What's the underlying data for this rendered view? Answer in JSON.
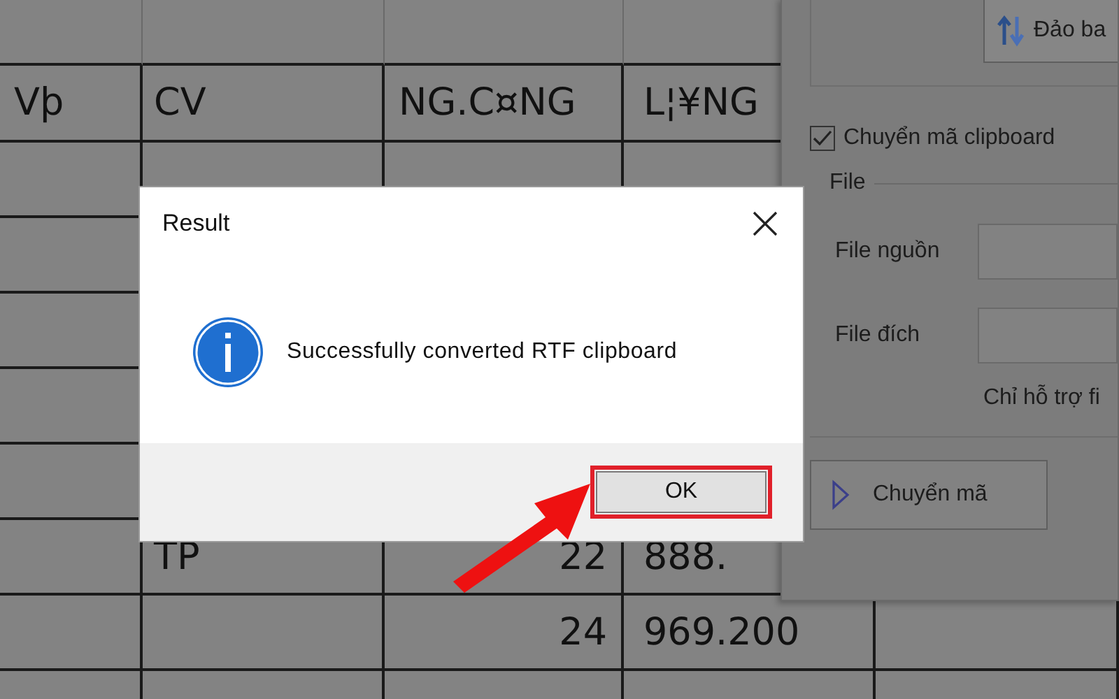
{
  "sheet": {
    "columns": [
      "Vþ",
      "CV",
      "NG.C¤NG",
      "L¦¥NG"
    ],
    "rows": [
      {},
      {},
      {},
      {},
      {},
      {
        "cv": "TP",
        "days": "22",
        "salary": "888."
      },
      {
        "days": "24",
        "salary": "969.200"
      },
      {}
    ]
  },
  "panel": {
    "swap_button": "Đảo ba",
    "clipboard_checkbox": {
      "label": "Chuyển mã clipboard",
      "checked": true
    },
    "file_group": "File",
    "fields": [
      {
        "label": "File nguồn"
      },
      {
        "label": "File đích"
      }
    ],
    "note": "Chỉ hỗ trợ fi",
    "convert_button": "Chuyển mã"
  },
  "dialog": {
    "title": "Result",
    "message": "Successfully converted RTF clipboard",
    "button": "OK"
  }
}
